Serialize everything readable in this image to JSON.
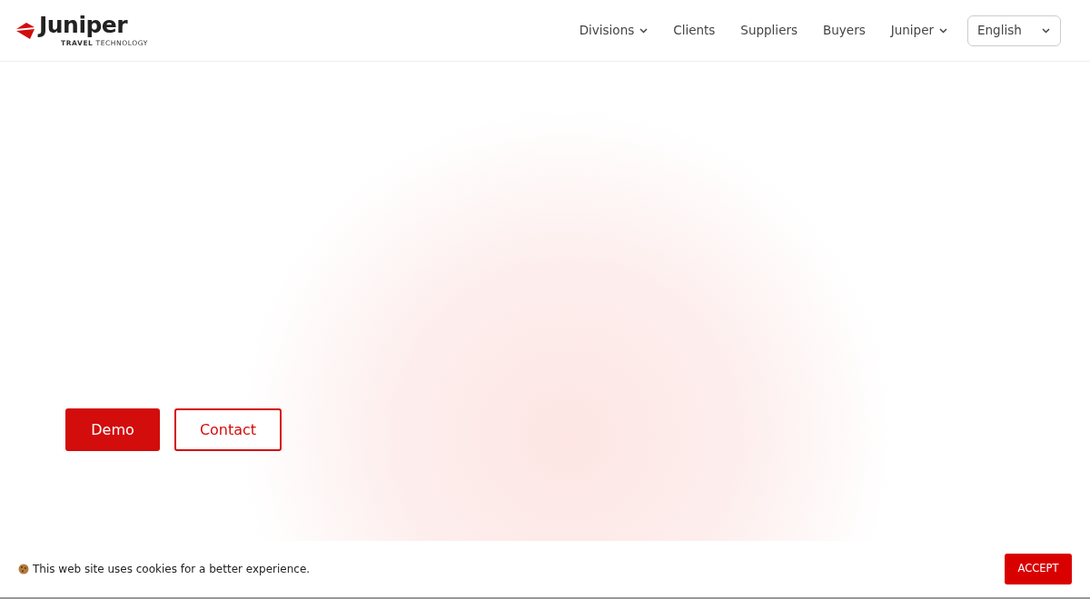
{
  "logo": {
    "name": "Juniper",
    "tagline_bold": "TRAVEL",
    "tagline": "TECHNOLOGY"
  },
  "nav": [
    {
      "label": "Divisions",
      "dropdown": true
    },
    {
      "label": "Clients",
      "dropdown": false
    },
    {
      "label": "Suppliers",
      "dropdown": false
    },
    {
      "label": "Buyers",
      "dropdown": false
    },
    {
      "label": "Juniper",
      "dropdown": true
    }
  ],
  "language": {
    "value": "English"
  },
  "hero_buttons": [
    {
      "label": "Demo",
      "kind": "solid"
    },
    {
      "label": "Contact",
      "kind": "outline"
    }
  ],
  "cookie_bar": {
    "message": "This web site uses cookies for a better experience.",
    "button": "ACCEPT"
  }
}
